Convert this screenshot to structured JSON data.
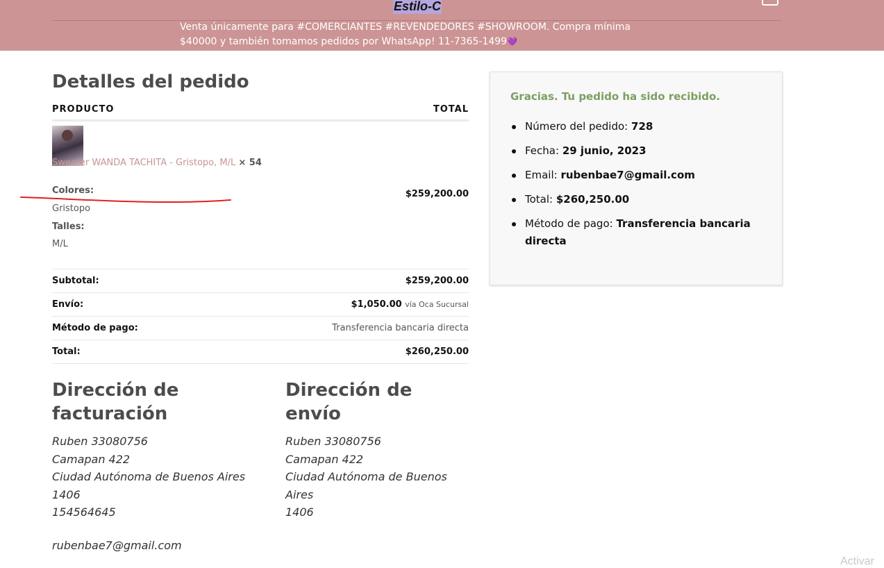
{
  "header": {
    "brand": "Estilo-C",
    "notice": "Venta únicamente para #COMERCIANTES #REVENDEDORES #SHOWROOM. Compra mínima $40000 y también tomamos pedidos por WhatsApp! 11-7365-1499",
    "notice_icon": "purple-heart"
  },
  "order_details": {
    "title": "Detalles del pedido",
    "col_product": "PRODUCTO",
    "col_total": "TOTAL",
    "item": {
      "name": "Sweater WANDA TACHITA - Gristopo, M/L",
      "qty": "× 54",
      "attr1_label": "Colores:",
      "attr1_value": "Gristopo",
      "attr2_label": "Talles:",
      "attr2_value": "M/L",
      "line_total": "$259,200.00"
    },
    "summary": [
      {
        "label": "Subtotal:",
        "value": "$259,200.00"
      },
      {
        "label": "Envío:",
        "value": "$1,050.00",
        "note": "vía Oca Sucursal"
      },
      {
        "label": "Método de pago:",
        "value": "Transferencia bancaria directa"
      },
      {
        "label": "Total:",
        "value": "$260,250.00"
      }
    ]
  },
  "billing": {
    "title": "Dirección de facturación",
    "lines": [
      "Ruben 33080756",
      "Camapan 422",
      "Ciudad Autónoma de Buenos Aires",
      "1406",
      "154564645"
    ],
    "email": "rubenbae7@gmail.com"
  },
  "shipping": {
    "title": "Dirección de envío",
    "lines": [
      "Ruben 33080756",
      "Camapan 422",
      "Ciudad Autónoma de Buenos Aires",
      "1406"
    ]
  },
  "confirmation": {
    "thanks": "Gracias. Tu pedido ha sido recibido.",
    "items": [
      {
        "label": "Número del pedido:",
        "value": "728"
      },
      {
        "label": "Fecha:",
        "value": "29 junio, 2023"
      },
      {
        "label": "Email:",
        "value": "rubenbae7@gmail.com"
      },
      {
        "label": "Total:",
        "value": "$260,250.00"
      },
      {
        "label": "Método de pago:",
        "value": "Transferencia bancaria directa"
      }
    ]
  },
  "watermark": "Activar",
  "colors": {
    "header_bg": "#cc9494",
    "link": "#c99494",
    "thanks": "#7ba061",
    "annotation": "#e02020"
  }
}
